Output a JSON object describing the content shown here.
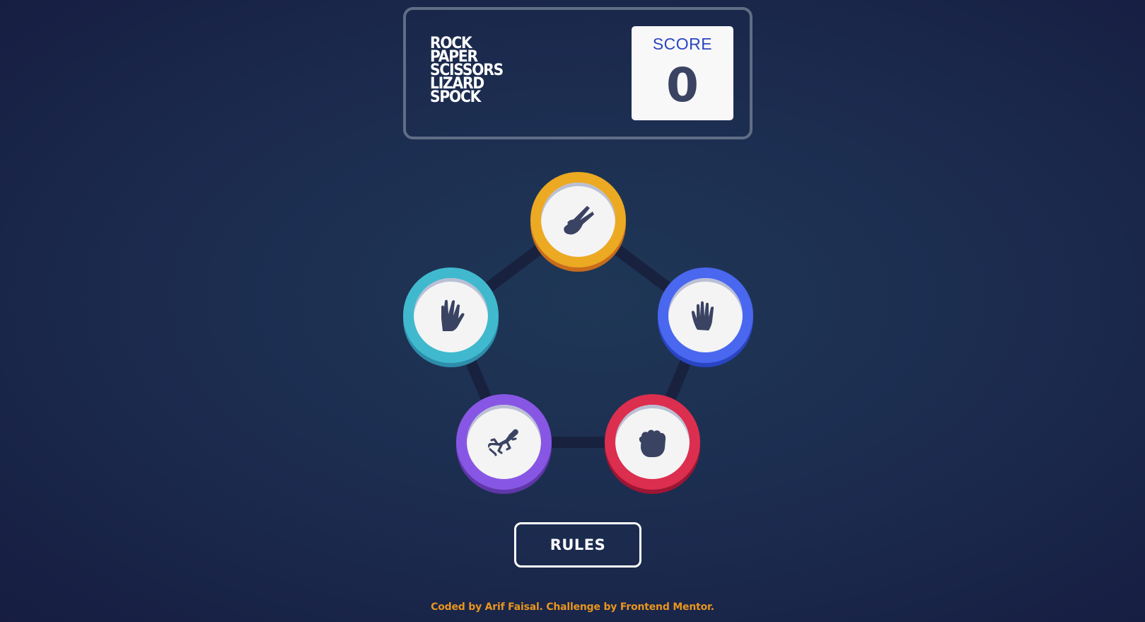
{
  "header": {
    "title_lines": [
      "ROCK",
      "PAPER",
      "SCISSORS",
      "LIZARD",
      "SPOCK"
    ],
    "score_label": "SCORE",
    "score_value": "0"
  },
  "tokens": [
    {
      "id": "scissors",
      "icon": "scissors-hand-icon",
      "ring_color": "#eca922",
      "shadow_color": "#c76c1b"
    },
    {
      "id": "paper",
      "icon": "paper-hand-icon",
      "ring_color": "#4a67f0",
      "shadow_color": "#2945c3"
    },
    {
      "id": "rock",
      "icon": "rock-fist-icon",
      "ring_color": "#dc2e4e",
      "shadow_color": "#9d1634"
    },
    {
      "id": "lizard",
      "icon": "lizard-icon",
      "ring_color": "#8856e4",
      "shadow_color": "#5f37a8"
    },
    {
      "id": "spock",
      "icon": "spock-hand-icon",
      "ring_color": "#40b9ce",
      "shadow_color": "#2d8dab"
    }
  ],
  "rules_button": {
    "label": "RULES"
  },
  "attribution": {
    "prefix": "Coded by ",
    "author": "Arif Faisal",
    "middle": ". Challenge by ",
    "org": "Frontend Mentor",
    "suffix": "."
  },
  "colors": {
    "background_light": "#1f3756",
    "background_dark": "#141539",
    "header_border": "#606e85",
    "score_label": "#2a46c0",
    "score_value": "#3b4363",
    "icon": "#3b4363",
    "attribution": "#e9951d"
  }
}
